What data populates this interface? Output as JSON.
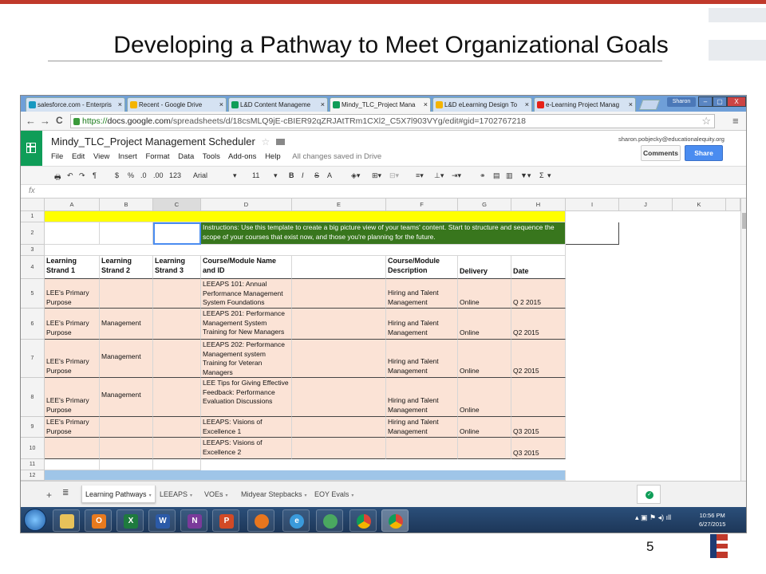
{
  "slide": {
    "title": "Developing a Pathway to Meet Organizational Goals",
    "page_number": "5"
  },
  "browser": {
    "tabs": [
      {
        "label": "salesforce.com - Enterpris",
        "close": "×",
        "color": "#1798c1"
      },
      {
        "label": "Recent - Google Drive",
        "close": "×",
        "color": "#f4b400"
      },
      {
        "label": "L&D Content Manageme",
        "close": "×",
        "color": "#0f9d58"
      },
      {
        "label": "Mindy_TLC_Project Mana",
        "close": "×",
        "color": "#0f9d58"
      },
      {
        "label": "L&D eLearning Design To",
        "close": "×",
        "color": "#f4b400"
      },
      {
        "label": "e-Learning Project Manag",
        "close": "×",
        "color": "#e62117"
      }
    ],
    "user": "Sharon",
    "window_buttons": [
      "–",
      "▢",
      "X"
    ],
    "url_prefix": "https://",
    "url_host": "docs.google.com",
    "url_path": "/spreadsheets/d/18csMLQ9jE-cBIER92qZRJAtTRm1CXl2_C5X7l903VYg/edit#gid=1702767218",
    "nav_back": "←",
    "nav_forward": "→",
    "nav_reload": "C",
    "star": "☆",
    "menu": "≡"
  },
  "sheets": {
    "doc_title": "Mindy_TLC_Project Management Scheduler",
    "star": "☆",
    "menus": [
      "File",
      "Edit",
      "View",
      "Insert",
      "Format",
      "Data",
      "Tools",
      "Add-ons",
      "Help"
    ],
    "saved_status": "All changes saved in Drive",
    "email": "sharon.pobjecky@educationalequity.org",
    "comments_label": "Comments",
    "share_label": "Share",
    "toolbar": {
      "currency": "$",
      "percent": "%",
      "dec_less": ".0",
      "dec_more": ".00",
      "format_123": "123",
      "font": "Arial",
      "size": "11",
      "bold": "B",
      "italic": "I",
      "strike": "S",
      "text_color": "A",
      "sigma": "Σ"
    },
    "fx": "fx"
  },
  "grid": {
    "columns": [
      "A",
      "B",
      "C",
      "D",
      "E",
      "F",
      "G",
      "H",
      "I",
      "J",
      "K"
    ],
    "row_numbers": [
      "1",
      "2",
      "3",
      "4",
      "5",
      "6",
      "7",
      "8",
      "9",
      "10",
      "11",
      "12"
    ],
    "instructions": "Instructions: Use this template to create a big picture view of your teams' content. Start to structure and sequence the scope of your courses that exist now, and those you're planning for the future.",
    "headers": {
      "a": "Learning Strand 1",
      "b": "Learning Strand 2",
      "c": "Learning Strand 3",
      "d": "Course/Module Name and ID",
      "f": "Course/Module Description",
      "g": "Delivery",
      "h": "Date"
    },
    "rows": [
      {
        "a": "LEE's Primary Purpose",
        "b": "",
        "d": "LEEAPS 101:  Annual Performance Management System Foundations",
        "f": "Hiring and Talent Management",
        "g": "Online",
        "h": "Q 2 2015"
      },
      {
        "a": "LEE's Primary Purpose",
        "b": "Management",
        "d": "LEEAPS 201: Performance Management System Training for New Managers",
        "f": "Hiring and Talent Management",
        "g": "Online",
        "h": "Q2 2015"
      },
      {
        "a": "LEE's Primary Purpose",
        "b": "Management",
        "d": "LEEAPS 202: Performance Management system Training for Veteran Managers",
        "f": "Hiring and Talent Management",
        "g": "Online",
        "h": "Q2 2015"
      },
      {
        "a": "LEE's Primary Purpose",
        "b": "Management",
        "d": "LEE Tips for Giving Effective Feedback: Performance Evaluation Discussions",
        "f": "Hiring and Talent Management",
        "g": "Online",
        "h": ""
      },
      {
        "a": "LEE's Primary Purpose",
        "b": "",
        "d": "LEEAPS: Visions of Excellence 1",
        "f": "Hiring and Talent Management",
        "g": "Online",
        "h": "Q3 2015"
      },
      {
        "a": "",
        "b": "",
        "d": "LEEAPS: Visions of Excellence 2",
        "f": "",
        "g": "",
        "h": "Q3 2015"
      }
    ]
  },
  "sheet_tabs": [
    {
      "label": "Learning Pathways",
      "active": true
    },
    {
      "label": "LEEAPS",
      "active": false
    },
    {
      "label": "VOEs",
      "active": false
    },
    {
      "label": "Midyear Stepbacks",
      "active": false
    },
    {
      "label": "EOY Evals",
      "active": false
    }
  ],
  "sheet_add": "+",
  "taskbar": {
    "time": "10:56 PM",
    "date": "6/27/2015"
  }
}
